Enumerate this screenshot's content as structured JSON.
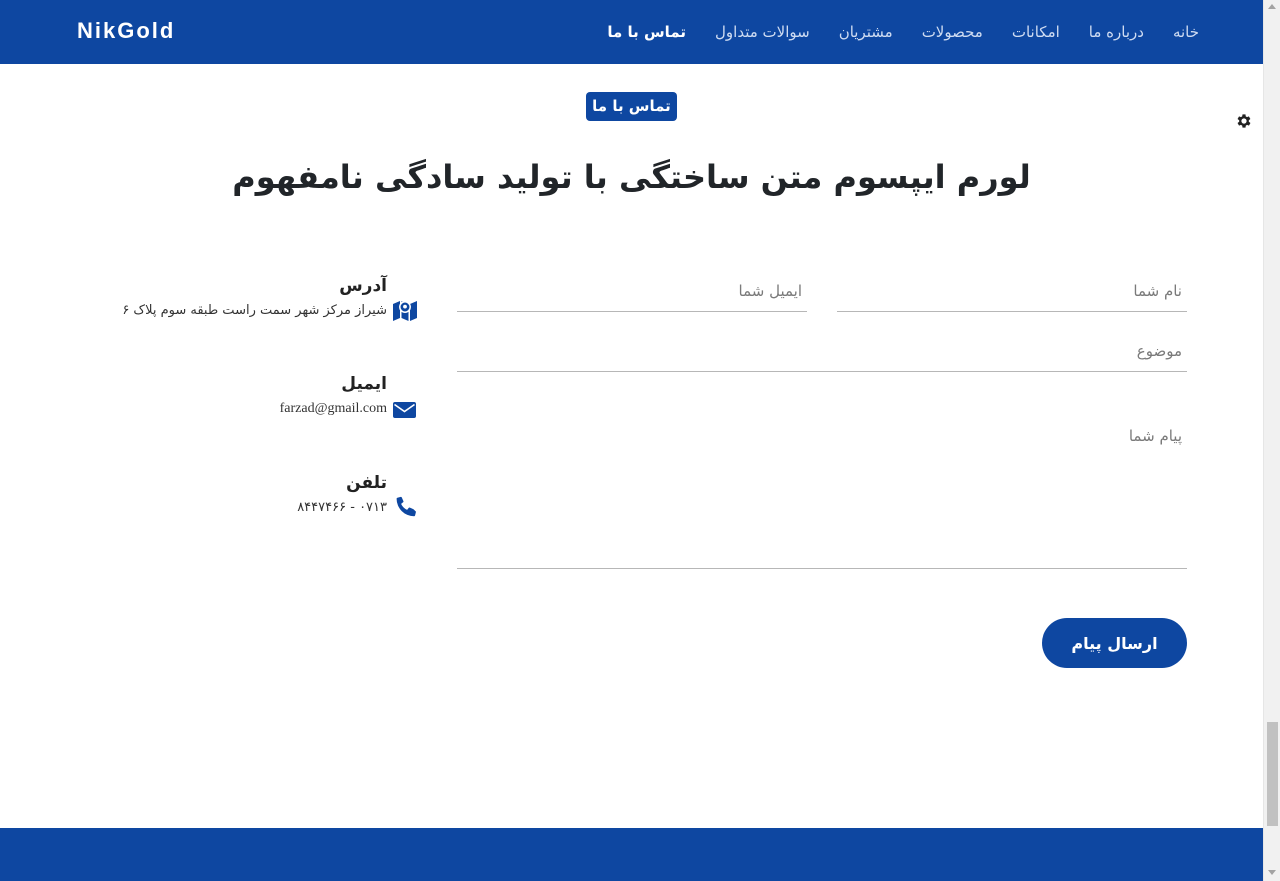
{
  "brand": "NikGold",
  "nav": {
    "items": [
      {
        "label": "خانه"
      },
      {
        "label": "درباره ما"
      },
      {
        "label": "امکانات"
      },
      {
        "label": "محصولات"
      },
      {
        "label": "مشتریان"
      },
      {
        "label": "سوالات متداول"
      },
      {
        "label": "تماس با ما",
        "active": true
      }
    ]
  },
  "section": {
    "badge": "تماس با ما",
    "title": "لورم ایپسوم متن ساختگی با تولید سادگی نامفهوم"
  },
  "contact": {
    "address": {
      "title": "آدرس",
      "value": "شیراز مرکز شهر سمت راست طبقه سوم پلاک ۶",
      "icon": "map-icon"
    },
    "email": {
      "title": "ایمیل",
      "value": "farzad@gmail.com",
      "icon": "envelope-icon"
    },
    "phone": {
      "title": "تلفن",
      "value": "۰۷۱۳ - ۸۴۴۷۴۶۶",
      "icon": "phone-icon"
    }
  },
  "form": {
    "name_placeholder": "نام شما",
    "email_placeholder": "ایمیل شما",
    "subject_placeholder": "موضوع",
    "message_placeholder": "پیام شما",
    "submit_label": "ارسال پیام"
  },
  "colors": {
    "primary": "#0e47a1",
    "text": "#212529"
  }
}
